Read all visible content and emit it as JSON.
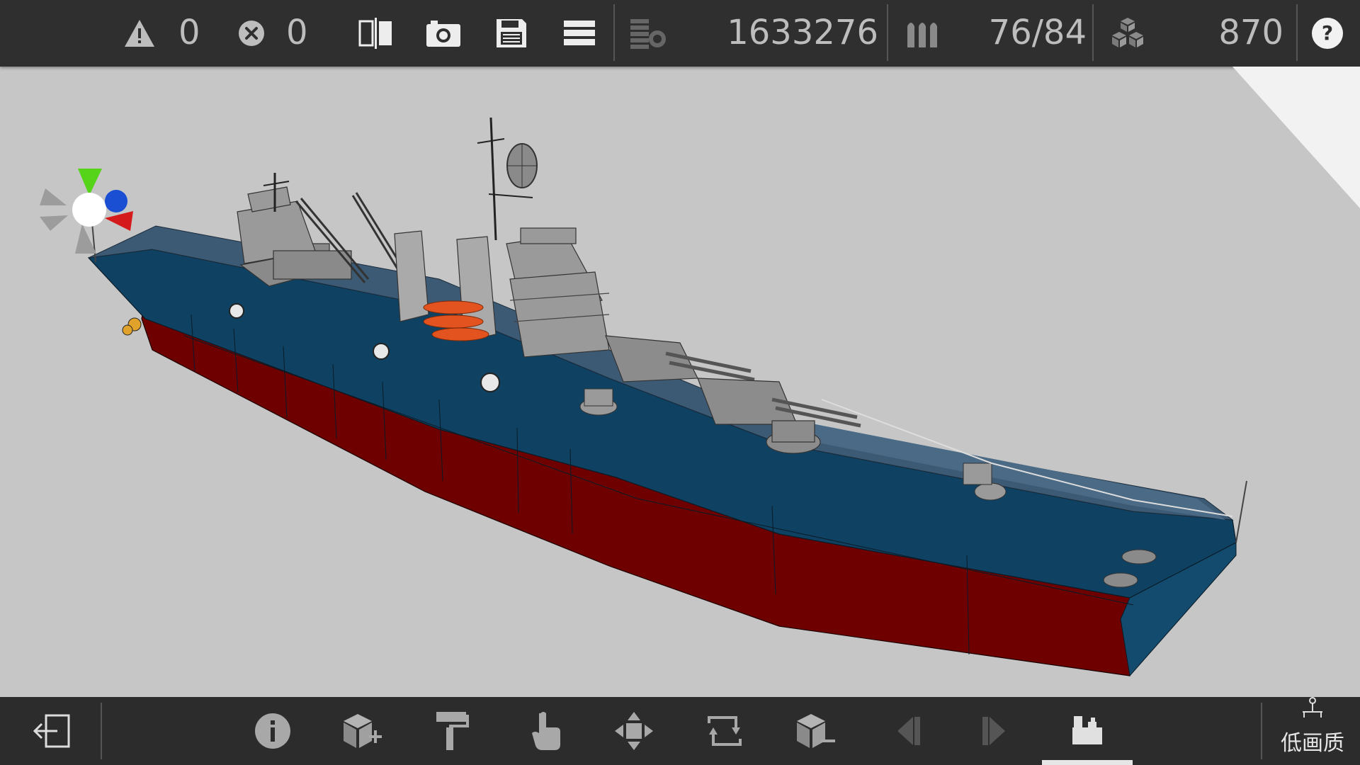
{
  "topbar": {
    "warnings_count": "0",
    "errors_count": "0",
    "points": "1633276",
    "ammo": "76/84",
    "parts": "870"
  },
  "bottombar": {
    "quality_label": "低画质"
  },
  "icons": {
    "warning": "warning-triangle-icon",
    "error": "error-x-circle-icon",
    "mirror": "mirror-icon",
    "camera": "camera-icon",
    "save": "save-icon",
    "menu": "menu-icon",
    "stack": "coin-stack-icon",
    "ammo": "ammo-icon",
    "blocks": "blocks-icon",
    "help": "help-icon"
  },
  "colors": {
    "hull_upper": "#0f4262",
    "hull_lower": "#6e0000",
    "superstructure": "#9a9a9a",
    "lifeboat": "#e2531f",
    "axis_x": "#d41a1a",
    "axis_y": "#55d41a",
    "axis_z": "#1a4fd4"
  }
}
